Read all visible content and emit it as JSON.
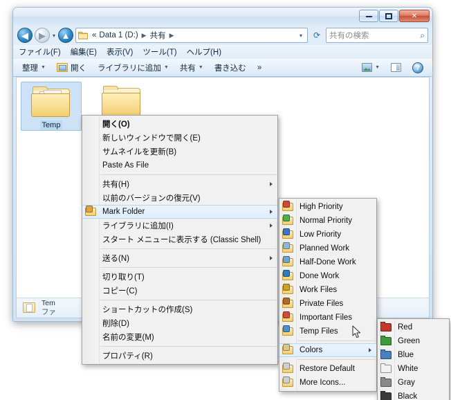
{
  "window": {
    "controls": {
      "minimize": "–",
      "maximize": "□",
      "close": "✕"
    },
    "address": {
      "prefix": "«",
      "crumbs": [
        "Data 1 (D:)",
        "共有"
      ],
      "dropdown_caret": "▾"
    },
    "search": {
      "placeholder": "共有の検索",
      "icon": "search-icon"
    },
    "menubar": [
      "ファイル(F)",
      "編集(E)",
      "表示(V)",
      "ツール(T)",
      "ヘルプ(H)"
    ],
    "toolbar": {
      "organize": "整理",
      "open": "開く",
      "add_to_library": "ライブラリに追加",
      "share": "共有",
      "burn": "書き込む",
      "overflow": "»"
    },
    "files": [
      {
        "name": "Temp",
        "selected": true
      },
      {
        "name": "",
        "selected": false
      }
    ],
    "status": {
      "line1": "Tem",
      "line2": "ファ"
    }
  },
  "context_menu": {
    "items": [
      {
        "label": "開く(O)",
        "bold": true
      },
      {
        "label": "新しいウィンドウで開く(E)"
      },
      {
        "label": "サムネイルを更新(B)"
      },
      {
        "label": "Paste As File"
      },
      {
        "separator": true
      },
      {
        "label": "共有(H)",
        "submenu": true
      },
      {
        "label": "以前のバージョンの復元(V)"
      },
      {
        "label": "Mark Folder",
        "submenu": true,
        "highlighted": true,
        "icon": "mark-folder-icon"
      },
      {
        "label": "ライブラリに追加(I)",
        "submenu": true
      },
      {
        "label": "スタート メニューに表示する (Classic Shell)"
      },
      {
        "separator": true
      },
      {
        "label": "送る(N)",
        "submenu": true
      },
      {
        "separator": true
      },
      {
        "label": "切り取り(T)"
      },
      {
        "label": "コピー(C)"
      },
      {
        "separator": true
      },
      {
        "label": "ショートカットの作成(S)"
      },
      {
        "label": "削除(D)"
      },
      {
        "label": "名前の変更(M)"
      },
      {
        "separator": true
      },
      {
        "label": "プロパティ(R)"
      }
    ]
  },
  "mark_folder_menu": {
    "items": [
      {
        "label": "High Priority",
        "badge": "#d14836"
      },
      {
        "label": "Normal Priority",
        "badge": "#4caf50"
      },
      {
        "label": "Low Priority",
        "badge": "#3f73c4"
      },
      {
        "label": "Planned Work",
        "badge": "#8fb8d8"
      },
      {
        "label": "Half-Done Work",
        "badge": "#6fa3cf"
      },
      {
        "label": "Done Work",
        "badge": "#2e7bbf"
      },
      {
        "label": "Work Files",
        "badge": "#c9a227"
      },
      {
        "label": "Private Files",
        "badge": "#b06a2c"
      },
      {
        "label": "Important Files",
        "badge": "#cf4b3a"
      },
      {
        "label": "Temp Files",
        "badge": "#4a90c9"
      },
      {
        "separator": true
      },
      {
        "label": "Colors",
        "submenu": true,
        "highlighted": true,
        "badge": "#d8c98a"
      },
      {
        "separator": true
      },
      {
        "label": "Restore Default"
      },
      {
        "label": "More Icons..."
      }
    ]
  },
  "colors_menu": {
    "items": [
      {
        "label": "Red",
        "color": "#c0392b"
      },
      {
        "label": "Green",
        "color": "#3d9a3d"
      },
      {
        "label": "Blue",
        "color": "#4a7fc1"
      },
      {
        "label": "White",
        "color": "#f2f2f2"
      },
      {
        "label": "Gray",
        "color": "#8a8a8a"
      },
      {
        "label": "Black",
        "color": "#3a3a3a"
      }
    ]
  }
}
